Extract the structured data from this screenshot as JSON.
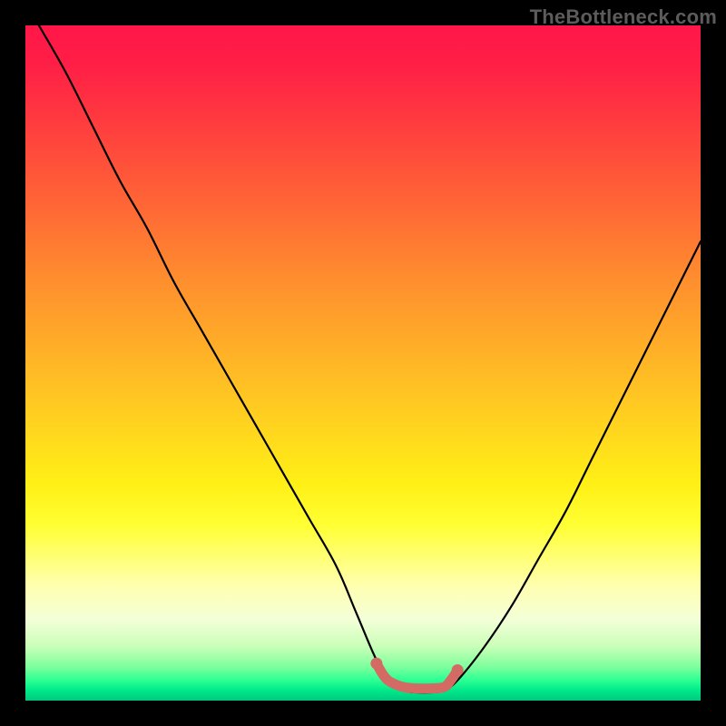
{
  "watermark": "TheBottleneck.com",
  "chart_data": {
    "type": "line",
    "title": "",
    "xlabel": "",
    "ylabel": "",
    "xlim": [
      0,
      100
    ],
    "ylim": [
      0,
      100
    ],
    "grid": false,
    "series": [
      {
        "name": "bottleneck-curve",
        "x": [
          2,
          6,
          10,
          14,
          18,
          22,
          26,
          30,
          34,
          38,
          42,
          46,
          49,
          52,
          54,
          56,
          58,
          60,
          62,
          64,
          68,
          72,
          76,
          80,
          84,
          88,
          92,
          96,
          100
        ],
        "values": [
          100,
          93,
          85,
          77,
          70,
          62,
          55,
          48,
          41,
          34,
          27,
          20,
          13,
          6,
          3,
          1.5,
          1.2,
          1.2,
          1.5,
          3,
          8,
          14,
          21,
          28,
          36,
          44,
          52,
          60,
          68
        ]
      },
      {
        "name": "optimal-region",
        "x": [
          52,
          53,
          54,
          56,
          58,
          60,
          62,
          63,
          64
        ],
        "values": [
          5.5,
          3.8,
          2.8,
          2.0,
          1.8,
          1.8,
          2.0,
          3.0,
          4.5
        ]
      }
    ],
    "colors": {
      "curve": "#000000",
      "optimal_region": "#d36a63",
      "gradient_top": "#ff1649",
      "gradient_bottom": "#00c97f"
    }
  }
}
